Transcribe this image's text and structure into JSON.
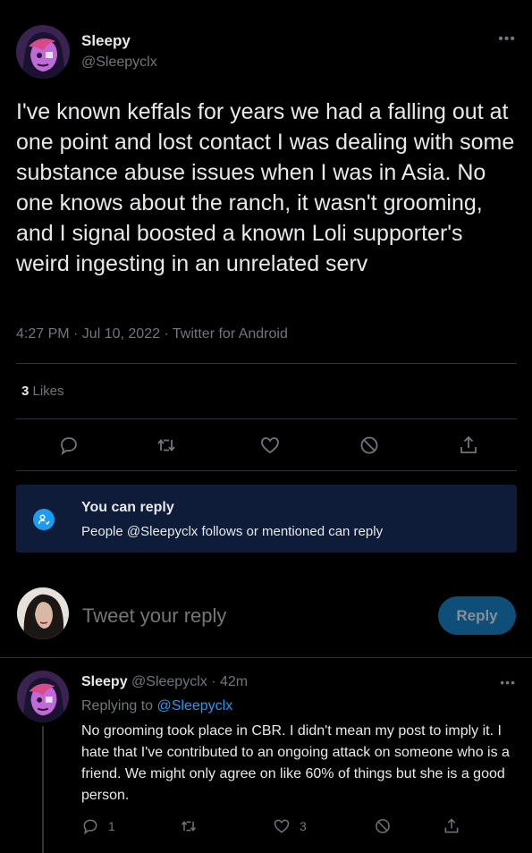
{
  "main_tweet": {
    "author_name": "Sleepy",
    "author_handle": "@Sleepyclx",
    "more_label": "•••",
    "text": "I've known keffals for years we had a falling out at one point and lost contact I was dealing with some substance abuse issues when I was in Asia. No one knows about the ranch, it wasn't grooming, and I signal boosted a known Loli supporter's weird ingesting in an unrelated serv",
    "meta": "4:27 PM · Jul 10, 2022 · Twitter for Android",
    "likes_count": "3",
    "likes_label": " Likes",
    "actions": [
      "reply-icon",
      "retweet-icon",
      "heart-icon",
      "block-icon",
      "share-icon"
    ]
  },
  "reply_banner": {
    "title": "You can reply",
    "subtitle": "People @Sleepyclx follows or mentioned can reply",
    "icon": "mention-person-icon"
  },
  "composer": {
    "placeholder": "Tweet your reply",
    "button_label": "Reply"
  },
  "reply_tweet": {
    "author_name": "Sleepy",
    "author_handle_time": " @Sleepyclx · 42m",
    "replying_prefix": "Replying to ",
    "replying_mention": "@Sleepyclx",
    "more_label": "•••",
    "text": "No grooming took place in CBR. I didn't mean my post to imply it. I hate that I've contributed to an ongoing attack on someone who is a friend. We might only agree on like 60% of things but she is a good person.",
    "reply_count": "1",
    "like_count": "3"
  },
  "colors": {
    "background": "#000000",
    "text": "#e7e9ea",
    "muted": "#71767b",
    "accent": "#1d9bf0",
    "banner": "#0e1c3a"
  }
}
